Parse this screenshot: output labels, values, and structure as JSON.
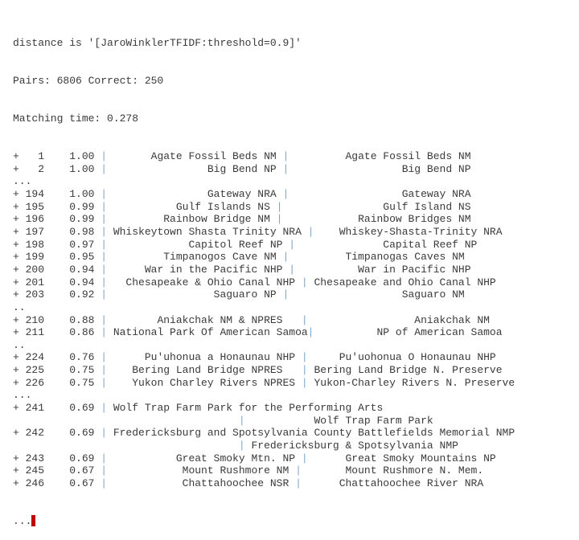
{
  "console": {
    "header": [
      "distance is '[JaroWinklerTFIDF:threshold=0.9]'",
      "Pairs: 6806 Correct: 250",
      "Matching time: 0.278"
    ],
    "lines": [
      {
        "type": "row",
        "text": "+   1    1.00 ",
        "pipe": "|",
        "rest": "       Agate Fossil Beds NM ",
        "pipe2": "|",
        "rest2": "         Agate Fossil Beds NM"
      },
      {
        "type": "row",
        "text": "+   2    1.00 ",
        "pipe": "|",
        "rest": "                Big Bend NP ",
        "pipe2": "|",
        "rest2": "                  Big Bend NP"
      },
      {
        "type": "text",
        "text": "..."
      },
      {
        "type": "row",
        "text": "+ 194    1.00 ",
        "pipe": "|",
        "rest": "                Gateway NRA ",
        "pipe2": "|",
        "rest2": "                  Gateway NRA"
      },
      {
        "type": "row",
        "text": "+ 195    0.99 ",
        "pipe": "|",
        "rest": "           Gulf Islands NS ",
        "pipe2": "|",
        "rest2": "                Gulf Island NS"
      },
      {
        "type": "row",
        "text": "+ 196    0.99 ",
        "pipe": "|",
        "rest": "         Rainbow Bridge NM ",
        "pipe2": "|",
        "rest2": "            Rainbow Bridges NM"
      },
      {
        "type": "row",
        "text": "+ 197    0.98 ",
        "pipe": "|",
        "rest": " Whiskeytown Shasta Trinity NRA ",
        "pipe2": "|",
        "rest2": "    Whiskey-Shasta-Trinity NRA"
      },
      {
        "type": "row",
        "text": "+ 198    0.97 ",
        "pipe": "|",
        "rest": "             Capitol Reef NP ",
        "pipe2": "|",
        "rest2": "              Capital Reef NP"
      },
      {
        "type": "row",
        "text": "+ 199    0.95 ",
        "pipe": "|",
        "rest": "         Timpanogos Cave NM ",
        "pipe2": "|",
        "rest2": "         Timpanogas Caves NM"
      },
      {
        "type": "row",
        "text": "+ 200    0.94 ",
        "pipe": "|",
        "rest": "      War in the Pacific NHP ",
        "pipe2": "|",
        "rest2": "          War in Pacific NHP"
      },
      {
        "type": "row",
        "text": "+ 201    0.94 ",
        "pipe": "|",
        "rest": "   Chesapeake & Ohio Canal NHP ",
        "pipe2": "|",
        "rest2": " Chesapeake and Ohio Canal NHP"
      },
      {
        "type": "row",
        "text": "+ 203    0.92 ",
        "pipe": "|",
        "rest": "                 Saguaro NP ",
        "pipe2": "|",
        "rest2": "                  Saguaro NM"
      },
      {
        "type": "text",
        "text": ".."
      },
      {
        "type": "row",
        "text": "+ 210    0.88 ",
        "pipe": "|",
        "rest": "        Aniakchak NM & NPRES   ",
        "pipe2": "|",
        "rest2": "                 Aniakchak NM"
      },
      {
        "type": "row",
        "text": "+ 211    0.86 ",
        "pipe": "|",
        "rest": " National Park Of American Samoa",
        "pipe2": "|",
        "rest2": "          NP of American Samoa"
      },
      {
        "type": "text",
        "text": ".."
      },
      {
        "type": "row",
        "text": "+ 224    0.76 ",
        "pipe": "|",
        "rest": "      Pu'uhonua a Honaunau NHP ",
        "pipe2": "|",
        "rest2": "     Pu'uohonua O Honaunau NHP"
      },
      {
        "type": "row",
        "text": "+ 225    0.75 ",
        "pipe": "|",
        "rest": "    Bering Land Bridge NPRES   ",
        "pipe2": "|",
        "rest2": " Bering Land Bridge N. Preserve"
      },
      {
        "type": "row",
        "text": "+ 226    0.75 ",
        "pipe": "|",
        "rest": "    Yukon Charley Rivers NPRES ",
        "pipe2": "|",
        "rest2": " Yukon-Charley Rivers N. Preserve"
      },
      {
        "type": "text",
        "text": "..."
      },
      {
        "type": "row",
        "text": "+ 241    0.69 ",
        "pipe": "|",
        "rest": " Wolf Trap Farm Park for the Performing Arts",
        "pipe2": "",
        "rest2": ""
      },
      {
        "type": "cont",
        "text": "                                    ",
        "pipe": "|",
        "rest": "           Wolf Trap Farm Park"
      },
      {
        "type": "row",
        "text": "+ 242    0.69 ",
        "pipe": "|",
        "rest": " Fredericksburg and Spotsylvania County Battlefields Memorial NMP",
        "pipe2": "",
        "rest2": ""
      },
      {
        "type": "cont",
        "text": "                                    ",
        "pipe": "|",
        "rest": " Fredericksburg & Spotsylvania NMP"
      },
      {
        "type": "row",
        "text": "+ 243    0.69 ",
        "pipe": "|",
        "rest": "           Great Smoky Mtn. NP ",
        "pipe2": "|",
        "rest2": "      Great Smoky Mountains NP"
      },
      {
        "type": "row",
        "text": "+ 245    0.67 ",
        "pipe": "|",
        "rest": "            Mount Rushmore NM ",
        "pipe2": "|",
        "rest2": "       Mount Rushmore N. Mem."
      },
      {
        "type": "row",
        "text": "+ 246    0.67 ",
        "pipe": "|",
        "rest": "            Chattahoochee NSR ",
        "pipe2": "|",
        "rest2": "      Chattahoochee River NRA"
      }
    ],
    "prompt": "..."
  },
  "colors": {
    "text": "#3a3a3a",
    "pipe": "#7fa7c9",
    "cursor": "#c00000"
  }
}
